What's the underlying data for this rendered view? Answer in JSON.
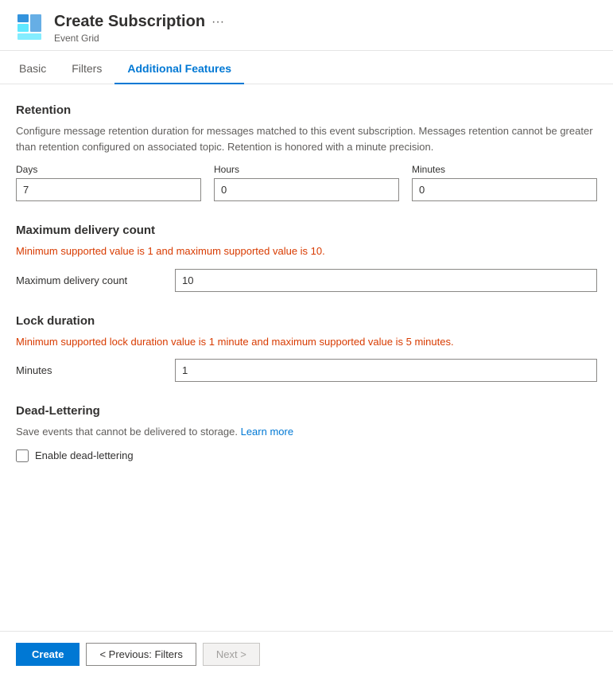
{
  "header": {
    "title": "Create Subscription",
    "subtitle": "Event Grid",
    "dots_label": "···"
  },
  "tabs": [
    {
      "id": "basic",
      "label": "Basic",
      "active": false
    },
    {
      "id": "filters",
      "label": "Filters",
      "active": false
    },
    {
      "id": "additional-features",
      "label": "Additional Features",
      "active": true
    }
  ],
  "sections": {
    "retention": {
      "title": "Retention",
      "description": "Configure message retention duration for messages matched to this event subscription. Messages retention cannot be greater than retention configured on associated topic. Retention is honored with a minute precision.",
      "fields": {
        "days_label": "Days",
        "days_value": "7",
        "hours_label": "Hours",
        "hours_value": "0",
        "minutes_label": "Minutes",
        "minutes_value": "0"
      }
    },
    "delivery_count": {
      "title": "Maximum delivery count",
      "description": "Minimum supported value is 1 and maximum supported value is 10.",
      "label": "Maximum delivery count",
      "value": "10"
    },
    "lock_duration": {
      "title": "Lock duration",
      "description": "Minimum supported lock duration value is 1 minute and maximum supported value is 5 minutes.",
      "label": "Minutes",
      "value": "1"
    },
    "dead_lettering": {
      "title": "Dead-Lettering",
      "description_prefix": "Save events that cannot be delivered to storage.",
      "learn_more_label": "Learn more",
      "learn_more_url": "#",
      "checkbox_label": "Enable dead-lettering"
    }
  },
  "footer": {
    "create_label": "Create",
    "prev_label": "< Previous: Filters",
    "next_label": "Next >"
  }
}
